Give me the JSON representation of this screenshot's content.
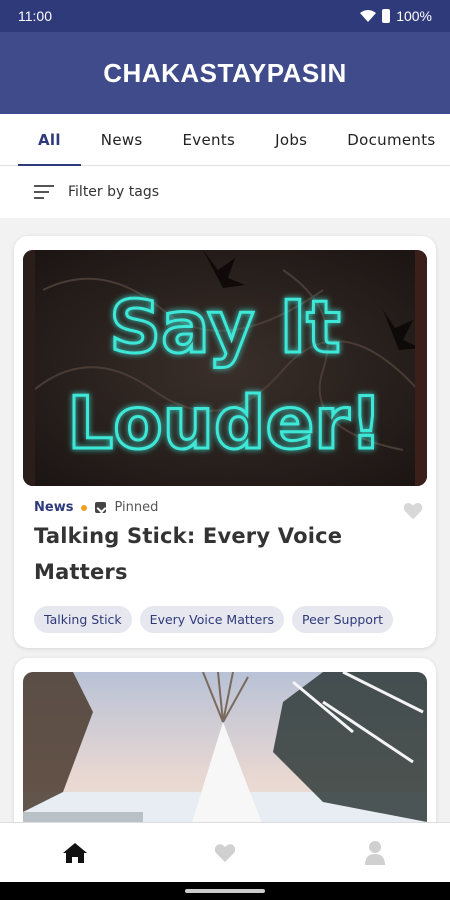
{
  "status_bar": {
    "time": "11:00",
    "battery": "100%"
  },
  "app": {
    "title": "CHAKASTAYPASIN"
  },
  "tabs": [
    {
      "label": "All",
      "active": true
    },
    {
      "label": "News"
    },
    {
      "label": "Events"
    },
    {
      "label": "Jobs"
    },
    {
      "label": "Documents"
    }
  ],
  "filter": {
    "label": "Filter by tags"
  },
  "cards": [
    {
      "image_text_line1": "Say It",
      "image_text_line2": "Louder!",
      "category": "News",
      "pinned_label": "Pinned",
      "title": "Talking Stick: Every Voice Matters",
      "tags": [
        "Talking Stick",
        "Every Voice Matters",
        "Peer Support"
      ]
    },
    {
      "image": "snowy-teepee-photo"
    }
  ],
  "colors": {
    "primary": "#2f3a7a",
    "header": "#3f4b8a",
    "accent_dot": "#f0a020",
    "neon": "#3ee8d8"
  },
  "bottom_nav": [
    {
      "icon": "home-icon",
      "active": true
    },
    {
      "icon": "heart-icon"
    },
    {
      "icon": "profile-icon"
    }
  ]
}
